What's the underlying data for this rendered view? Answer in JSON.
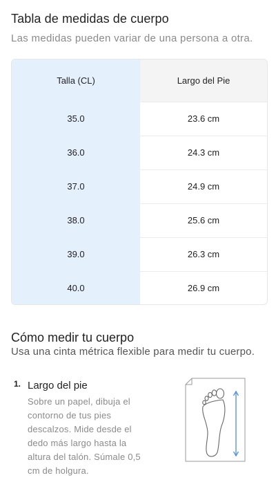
{
  "header": {
    "title": "Tabla de medidas de cuerpo",
    "subtitle": "Las medidas pueden variar de una persona a otra."
  },
  "size_table": {
    "columns": [
      "Talla (CL)",
      "Largo del Pie"
    ],
    "rows": [
      [
        "35.0",
        "23.6 cm"
      ],
      [
        "36.0",
        "24.3 cm"
      ],
      [
        "37.0",
        "24.9 cm"
      ],
      [
        "38.0",
        "25.6 cm"
      ],
      [
        "39.0",
        "26.3 cm"
      ],
      [
        "40.0",
        "26.9 cm"
      ]
    ],
    "colors": {
      "highlight_column": "#e5f0fd",
      "header_background": "#f4f4f4",
      "border": "#e6e6e6"
    }
  },
  "how_to_measure": {
    "title": "Cómo medir tu cuerpo",
    "description": "Usa una cinta métrica flexible para medir tu cuerpo.",
    "steps": [
      {
        "number": "1.",
        "title": "Largo del pie",
        "description": "Sobre un papel, dibuja el contorno de tus pies descalzos. Mide desde el dedo más largo hasta la altura del talón. Súmale 0,5 cm de holgura.",
        "illustration": "foot-outline-on-paper",
        "accent_color": "#3f7fe0"
      }
    ]
  }
}
